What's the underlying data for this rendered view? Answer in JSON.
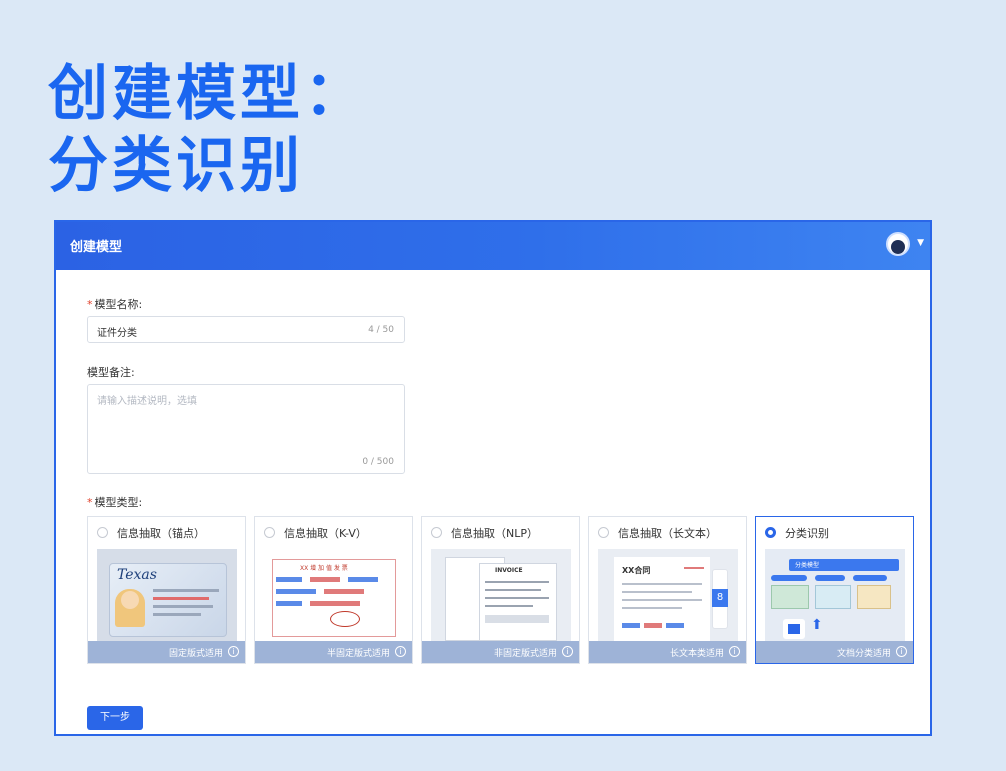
{
  "headline": {
    "line1": "创建模型：",
    "line2": "分类识别"
  },
  "app": {
    "title": "创建模型",
    "form": {
      "name_label": "模型名称:",
      "name_value": "证件分类",
      "name_count": "4 / 50",
      "note_label": "模型备注:",
      "note_placeholder": "请输入描述说明，选填",
      "note_count": "0 / 500",
      "type_label": "模型类型:"
    },
    "types": [
      {
        "name": "信息抽取（锚点）",
        "desc": "固定版式适用",
        "selected": false
      },
      {
        "name": "信息抽取（K-V）",
        "desc": "半固定版式适用",
        "selected": false
      },
      {
        "name": "信息抽取（NLP）",
        "desc": "非固定版式适用",
        "selected": false
      },
      {
        "name": "信息抽取（长文本）",
        "desc": "长文本类适用",
        "selected": false
      },
      {
        "name": "分类识别",
        "desc": "文档分类适用",
        "selected": true
      }
    ],
    "previews": {
      "texas": "Texas",
      "invoice_title": "XX 增 加 值 发 票",
      "nlp_heading": "INVOICE",
      "longtext_title": "XX合同",
      "page_number": "8",
      "classify_title": "分类模型"
    },
    "next_label": "下一步"
  },
  "colors": {
    "accent": "#2a66e8",
    "headline": "#1a66f0",
    "background": "#dbe8f6"
  },
  "icons": [
    "user-avatar-icon",
    "caret-down-icon",
    "info-icon",
    "radio-icon",
    "upload-icon",
    "arrow-up-icon"
  ]
}
